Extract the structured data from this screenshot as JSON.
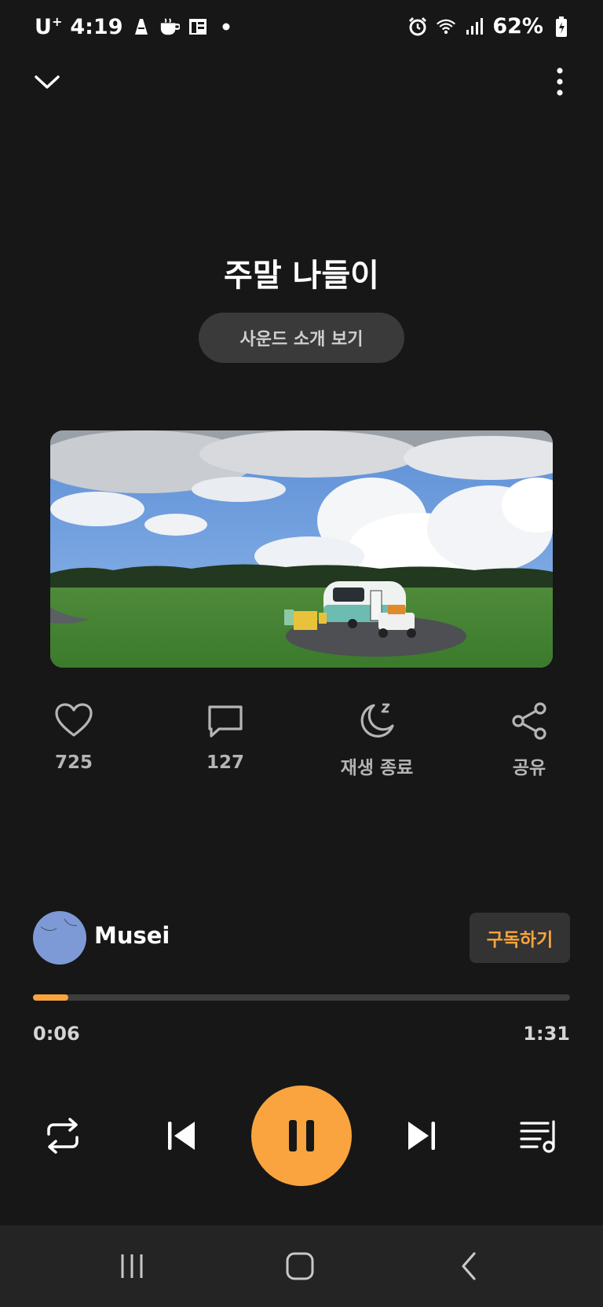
{
  "status_bar": {
    "carrier": "U",
    "carrier_sup": "+",
    "time": "4:19",
    "battery": "62%",
    "icons": [
      "notification-icon",
      "coffee-icon",
      "news-icon",
      "dot-icon",
      "alarm-icon",
      "wifi-icon",
      "signal-icon",
      "battery-icon"
    ]
  },
  "header": {
    "title": "주말 나들이",
    "intro_button": "사운드 소개 보기"
  },
  "actions": {
    "like_count": "725",
    "comment_count": "127",
    "sleep_timer_label": "재생 종료",
    "share_label": "공유"
  },
  "artist": {
    "name": "Musei",
    "subscribe_label": "구독하기"
  },
  "player": {
    "elapsed": "0:06",
    "total": "1:31",
    "progress_fraction": 0.066
  },
  "colors": {
    "accent": "#f9a43e",
    "background": "#171717",
    "pill": "#3a3a3a"
  }
}
